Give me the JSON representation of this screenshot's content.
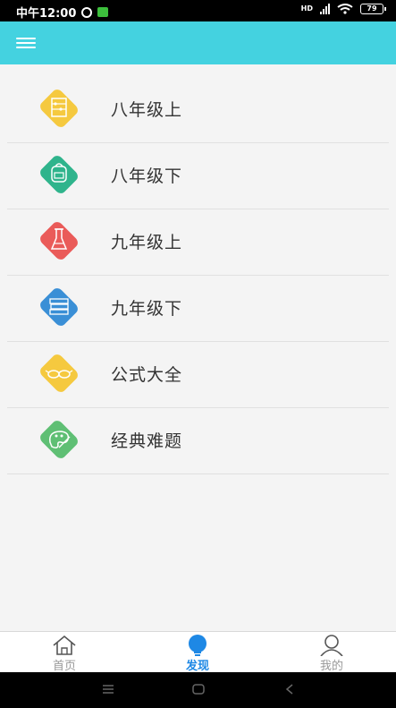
{
  "status_bar": {
    "time": "中午12:00",
    "hd": "HD",
    "battery": "79"
  },
  "colors": {
    "app_bar": "#44d2e0",
    "accent": "#1e88e5"
  },
  "list": {
    "items": [
      {
        "label": "八年级上",
        "icon": "abacus-icon",
        "color": "#f5c93f"
      },
      {
        "label": "八年级下",
        "icon": "backpack-icon",
        "color": "#2fb48c"
      },
      {
        "label": "九年级上",
        "icon": "flask-icon",
        "color": "#ea5b59"
      },
      {
        "label": "九年级下",
        "icon": "books-icon",
        "color": "#3a8fd6"
      },
      {
        "label": "公式大全",
        "icon": "glasses-icon",
        "color": "#f5c93f"
      },
      {
        "label": "经典难题",
        "icon": "palette-icon",
        "color": "#5fbf74"
      }
    ]
  },
  "bottom_nav": {
    "home": "首页",
    "discover": "发现",
    "mine": "我的"
  }
}
